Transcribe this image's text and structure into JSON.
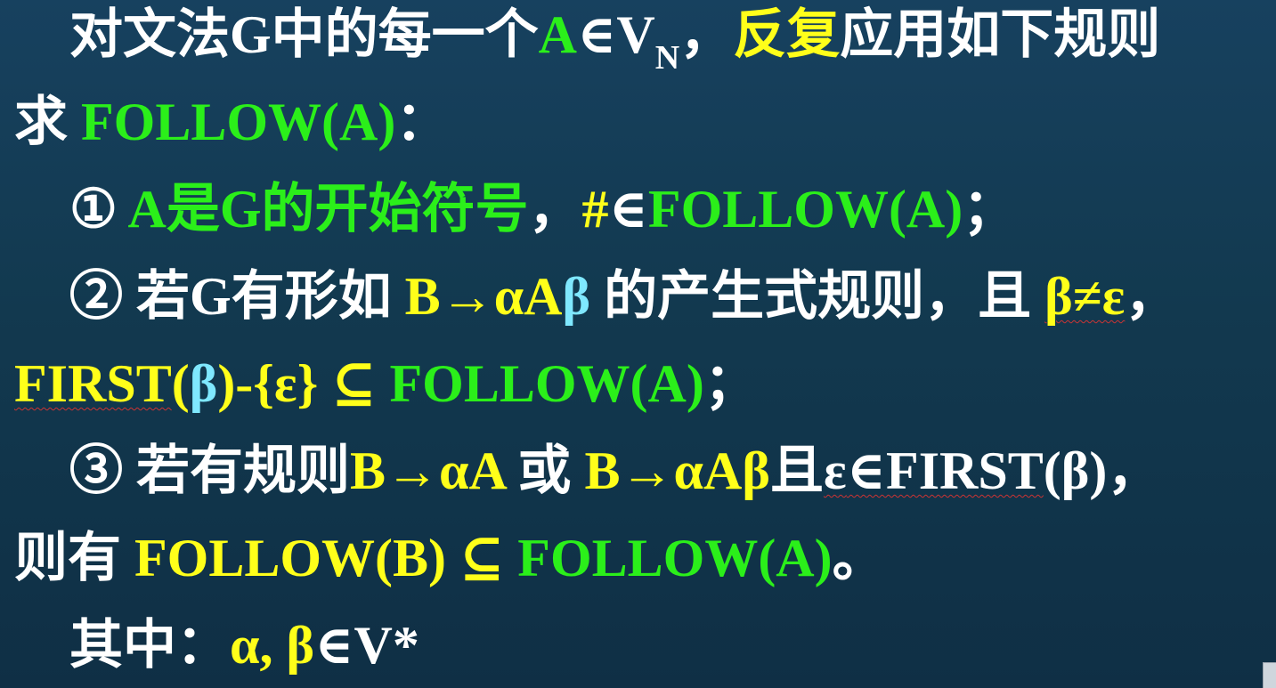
{
  "colors": {
    "background": "#153b57",
    "white_text": "#ffffff",
    "green_text": "#2bef1a",
    "yellow_text": "#ffff1a",
    "cyan_text": "#7fe8ff"
  },
  "intro": {
    "l1_a": "对文法G中的每一个",
    "l1_b": "A",
    "l1_c": "∈V",
    "l1_d": "N",
    "l1_e": "，",
    "l1_f": "反复",
    "l1_g": "应用如下规则",
    "l2_a": "求 ",
    "l2_b": "FOLLOW(A)",
    "l2_c": "："
  },
  "rule1": {
    "num": "①",
    "a": "A是G的开始符号",
    "b": "，",
    "c": "#",
    "d": "∈",
    "e": "FOLLOW(A)",
    "f": "；"
  },
  "rule2": {
    "num": "②",
    "a": " 若G有形如 ",
    "b": "B→αA",
    "c": "β",
    "d": " 的产生式规则，且 ",
    "e": "β≠ε",
    "f": "，",
    "g": "FIRST",
    "h": "(",
    "i": "β",
    "j": ")-{ε} ",
    "k": "⊆",
    "l": " FOLLOW(A)",
    "m": "；"
  },
  "rule3": {
    "num": "③",
    "a": " 若有规则",
    "b": "B→αA",
    "c": " 或 ",
    "d": "B→αAβ",
    "e": "且",
    "f": "ε",
    "g": "∈FIRST",
    "h": "(β)，",
    "i": "则有 ",
    "j": "FOLLOW(B) ",
    "k": "⊆",
    "l": " FOLLOW(A)",
    "m": "。"
  },
  "where": {
    "a": "其中：",
    "b": "α, β",
    "c": "∈V*"
  }
}
